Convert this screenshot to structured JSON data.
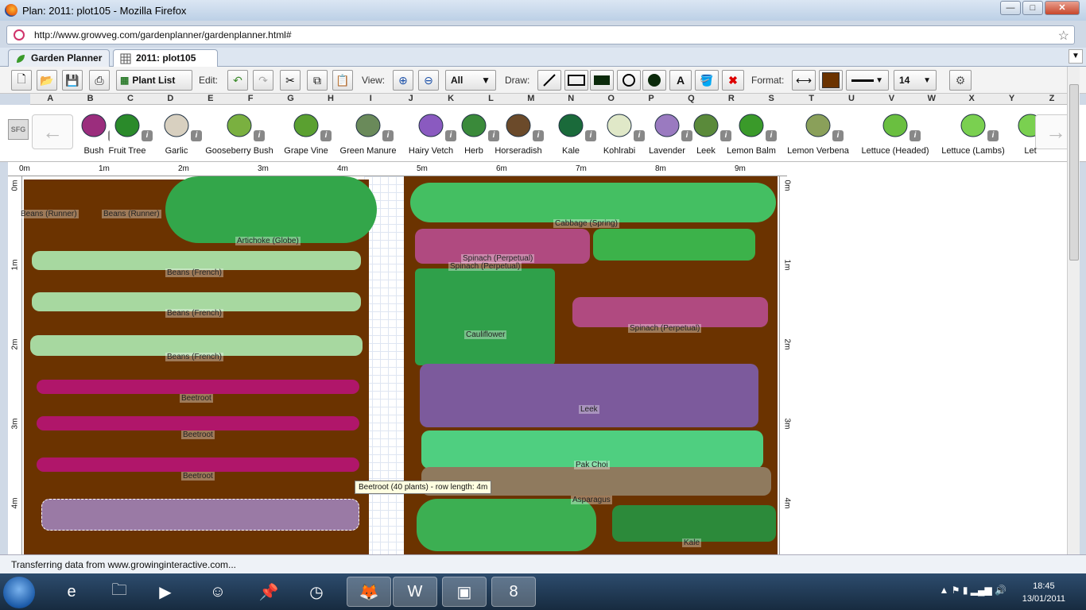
{
  "window": {
    "title": "Plan: 2011: plot105 - Mozilla Firefox",
    "minimize": "—",
    "maximize": "□",
    "close": "✕"
  },
  "browser": {
    "url": "http://www.growveg.com/gardenplanner/gardenplanner.html#"
  },
  "tabs": [
    {
      "label": "Garden Planner"
    },
    {
      "label": "2011: plot105"
    }
  ],
  "toolbar": {
    "plant_list": "Plant List",
    "edit_label": "Edit:",
    "view_label": "View:",
    "zoom_select": "All",
    "draw_label": "Draw:",
    "format_label": "Format:",
    "font_size": "14",
    "colors": {
      "fill": "#6b3300"
    }
  },
  "columns": [
    "A",
    "B",
    "C",
    "D",
    "E",
    "F",
    "G",
    "H",
    "I",
    "J",
    "K",
    "L",
    "M",
    "N",
    "O",
    "P",
    "Q",
    "R",
    "S",
    "T",
    "U",
    "V",
    "W",
    "X",
    "Y",
    "Z"
  ],
  "plantbar": {
    "sfg": "SFG",
    "prev": "←",
    "next": "→",
    "items": [
      {
        "name": "Bush",
        "icon": "bush-icon"
      },
      {
        "name": "Fruit Tree",
        "icon": "fruit-tree-icon"
      },
      {
        "name": "Garlic",
        "icon": "garlic-icon"
      },
      {
        "name": "Gooseberry Bush",
        "icon": "gooseberry-icon"
      },
      {
        "name": "Grape Vine",
        "icon": "grape-icon"
      },
      {
        "name": "Green Manure",
        "icon": "green-manure-icon"
      },
      {
        "name": "Hairy Vetch",
        "icon": "hairy-vetch-icon"
      },
      {
        "name": "Herb",
        "icon": "herb-icon"
      },
      {
        "name": "Horseradish",
        "icon": "horseradish-icon"
      },
      {
        "name": "Kale",
        "icon": "kale-icon"
      },
      {
        "name": "Kohlrabi",
        "icon": "kohlrabi-icon"
      },
      {
        "name": "Lavender",
        "icon": "lavender-icon"
      },
      {
        "name": "Leek",
        "icon": "leek-icon"
      },
      {
        "name": "Lemon Balm",
        "icon": "lemon-balm-icon"
      },
      {
        "name": "Lemon Verbena",
        "icon": "lemon-verbena-icon"
      },
      {
        "name": "Lettuce (Headed)",
        "icon": "lettuce-headed-icon"
      },
      {
        "name": "Lettuce (Lambs)",
        "icon": "lettuce-lambs-icon"
      },
      {
        "name": "Let",
        "icon": "lettuce-icon"
      }
    ],
    "info": "i"
  },
  "ruler": {
    "top": [
      "0m",
      "1m",
      "2m",
      "3m",
      "4m",
      "5m",
      "6m",
      "7m",
      "8m",
      "9m"
    ],
    "side": [
      "0m",
      "1m",
      "2m",
      "3m",
      "4m"
    ]
  },
  "plan": {
    "labels": [
      "Beans (Runner)",
      "Beans (Runner)",
      "Artichoke (Globe)",
      "Beans (French)",
      "Beans (French)",
      "Beans (French)",
      "Beetroot",
      "Beetroot",
      "Beetroot",
      "Cabbage (Spring)",
      "Spinach (Perpetual)",
      "Spinach (Perpetual)",
      "Spinach (Perpetual)",
      "Cauliflower",
      "Leek",
      "Pak Choi",
      "Asparagus",
      "Kale"
    ]
  },
  "tooltip": "Beetroot (40 plants) - row length: 4m",
  "status": "Transferring data from www.growinginteractive.com...",
  "taskbar": {
    "time": "18:45",
    "date": "13/01/2011",
    "icons": [
      "ie-icon",
      "explorer-icon",
      "media-icon",
      "user-icon",
      "pin-icon",
      "clock-icon",
      "firefox-icon",
      "word-icon",
      "photo-icon",
      "psp-icon"
    ]
  }
}
